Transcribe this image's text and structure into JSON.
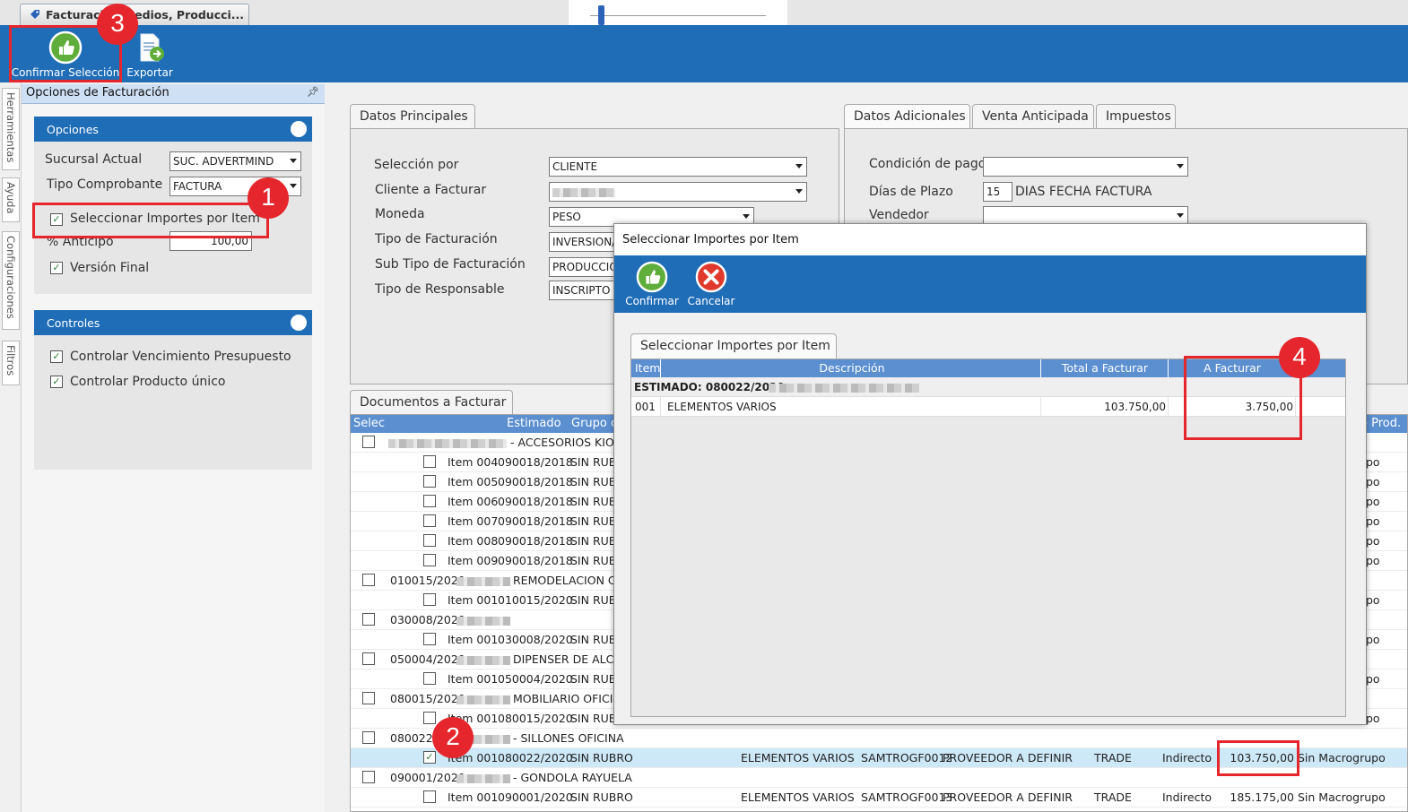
{
  "window": {
    "tab_title": "Facturación Medios, Producci..."
  },
  "ribbon": {
    "confirm_label": "Confirmar Selección",
    "export_label": "Exportar"
  },
  "side_tabs": [
    "Herramientas",
    "Ayuda",
    "Configuraciones",
    "Filtros"
  ],
  "options_pane": {
    "title": "Opciones de Facturación",
    "opciones": {
      "header": "Opciones",
      "sucursal_label": "Sucursal Actual",
      "sucursal_value": "SUC. ADVERTMIND",
      "tipo_comp_label": "Tipo Comprobante",
      "tipo_comp_value": "FACTURA",
      "seleccionar_label": "Seleccionar Importes por Item",
      "anticipo_label": "% Anticipo",
      "anticipo_value": "100,00",
      "version_label": "Versión Final"
    },
    "controles": {
      "header": "Controles",
      "vencimiento_label": "Controlar Vencimiento Presupuesto",
      "producto_label": "Controlar Producto único"
    }
  },
  "datos_principales": {
    "tab": "Datos Principales",
    "fields": [
      {
        "label": "Selección por",
        "value": "CLIENTE"
      },
      {
        "label": "Cliente a Facturar",
        "value": ""
      },
      {
        "label": "Moneda",
        "value": "PESO"
      },
      {
        "label": "Tipo de Facturación",
        "value": "INVERSION/"
      },
      {
        "label": "Sub Tipo de Facturación",
        "value": "PRODUCCIO"
      },
      {
        "label": "Tipo de Responsable",
        "value": "INSCRIPTO"
      }
    ]
  },
  "datos_adicionales": {
    "tabs": [
      "Datos Adicionales",
      "Venta Anticipada",
      "Impuestos"
    ],
    "condicion_label": "Condición de pago",
    "dias_label": "Días de Plazo",
    "dias_value": "15",
    "dias_text": "DIAS FECHA FACTURA",
    "vendedor_label": "Vendedor"
  },
  "documentos": {
    "tab": "Documentos a Facturar",
    "headers": {
      "selec": "Selec",
      "estimado": "Estimado",
      "grupo": "Grupo c",
      "prod": "o Prod."
    },
    "rows": [
      {
        "type": "group",
        "estimado": "",
        "text": "- ACCESORIOS KIOS"
      },
      {
        "type": "item",
        "item": "Item 004",
        "estimado": "090018/2018",
        "rubro": "SIN RUBR",
        "tail": "po"
      },
      {
        "type": "item",
        "item": "Item 005",
        "estimado": "090018/2018",
        "rubro": "SIN RUBR",
        "tail": "po"
      },
      {
        "type": "item",
        "item": "Item 006",
        "estimado": "090018/2018",
        "rubro": "SIN RUBR",
        "tail": "po"
      },
      {
        "type": "item",
        "item": "Item 007",
        "estimado": "090018/2018",
        "rubro": "SIN RUBR",
        "tail": "po"
      },
      {
        "type": "item",
        "item": "Item 008",
        "estimado": "090018/2018",
        "rubro": "SIN RUBR",
        "tail": "po"
      },
      {
        "type": "item",
        "item": "Item 009",
        "estimado": "090018/2018",
        "rubro": "SIN RUBR",
        "tail": "po"
      },
      {
        "type": "group",
        "estimado": "010015/2020",
        "text": "REMODELACION CA"
      },
      {
        "type": "item",
        "item": "Item 001",
        "estimado": "010015/2020",
        "rubro": "SIN RUBR",
        "tail": "po"
      },
      {
        "type": "group",
        "estimado": "030008/2020",
        "text": ""
      },
      {
        "type": "item",
        "item": "Item 001",
        "estimado": "030008/2020",
        "rubro": "SIN RUBR",
        "tail": "po"
      },
      {
        "type": "group",
        "estimado": "050004/2020",
        "text": "DIPENSER DE ALCOHO"
      },
      {
        "type": "item",
        "item": "Item 001",
        "estimado": "050004/2020",
        "rubro": "SIN RUBR",
        "tail": "po"
      },
      {
        "type": "group",
        "estimado": "080015/2020",
        "text": "MOBILIARIO OFICIN."
      },
      {
        "type": "item",
        "item": "Item 001",
        "estimado": "080015/2020",
        "rubro": "SIN RUBR",
        "tail": "po"
      },
      {
        "type": "group",
        "estimado": "080022/2020",
        "text": "- SILLONES OFICINA"
      },
      {
        "type": "item-full",
        "checked": true,
        "item": "Item 001",
        "estimado": "080022/2020",
        "rubro": "SIN RUBRO",
        "desc": "ELEMENTOS VARIOS",
        "code": "SAMTROGF0012",
        "prov": "PROVEEDOR A DEFINIR",
        "trade": "TRADE",
        "ind": "Indirecto",
        "total": "103.750,00",
        "macro": "Sin Macrogrupo"
      },
      {
        "type": "group",
        "estimado": "090001/2020",
        "text": "- GONDOLA RAYUELA"
      },
      {
        "type": "item-full",
        "checked": false,
        "item": "Item 001",
        "estimado": "090001/2020",
        "rubro": "SIN RUBRO",
        "desc": "ELEMENTOS VARIOS",
        "code": "SAMTROGF0013",
        "prov": "PROVEEDOR A DEFINIR",
        "trade": "TRADE",
        "ind": "Indirecto",
        "total": "185.175,00",
        "macro": "Sin Macrogrupo"
      }
    ]
  },
  "modal": {
    "title": "Seleccionar Importes por Item",
    "confirm": "Confirmar",
    "cancel": "Cancelar",
    "tab": "Seleccionar Importes por Item",
    "headers": {
      "item": "Item",
      "desc": "Descripción",
      "total": "Total a Facturar",
      "afacturar": "A Facturar"
    },
    "group_label": "ESTIMADO: 080022/2020",
    "row": {
      "item": "001",
      "desc": "ELEMENTOS VARIOS",
      "total": "103.750,00",
      "afacturar": "3.750,00"
    }
  },
  "annotations": [
    "1",
    "2",
    "3",
    "4"
  ],
  "colors": {
    "ribbon": "#1f6db7",
    "grid_header": "#5b8fd0",
    "callout": "#e5262c",
    "selected_row": "#cde8f7"
  }
}
